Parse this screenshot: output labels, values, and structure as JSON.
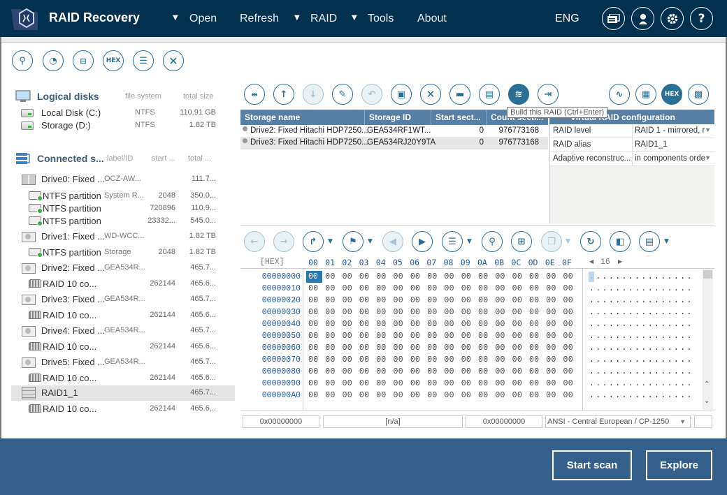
{
  "app": {
    "title": "RAID Recovery"
  },
  "menu": {
    "open": "Open",
    "refresh": "Refresh",
    "raid": "RAID",
    "tools": "Tools",
    "about": "About",
    "lang": "ENG"
  },
  "top_icons": [
    "messages-icon",
    "user-icon",
    "settings-icon",
    "help-icon"
  ],
  "left_toolbar": {
    "hex_label": "HEX"
  },
  "logical_disks": {
    "title": "Logical disks",
    "col_fs": "file system",
    "col_size": "total size",
    "items": [
      {
        "name": "Local Disk (C:)",
        "fs": "NTFS",
        "size": "110.91 GB"
      },
      {
        "name": "Storage (D:)",
        "fs": "NTFS",
        "size": "1.82 TB"
      }
    ]
  },
  "connected": {
    "title": "Connected s...",
    "col_label": "label/ID",
    "col_start": "start ...",
    "col_total": "total ...",
    "items": [
      {
        "type": "drive0",
        "name": "Drive0: Fixed ...",
        "id": "OCZ-AW...",
        "start": "",
        "total": "111.7..."
      },
      {
        "type": "part",
        "name": "NTFS partition",
        "id": "System R...",
        "start": "2048",
        "total": "350.0..."
      },
      {
        "type": "part",
        "name": "NTFS partition",
        "id": "",
        "start": "720896",
        "total": "110.9..."
      },
      {
        "type": "part",
        "name": "NTFS partition",
        "id": "",
        "start": "23332...",
        "total": "545.0..."
      },
      {
        "type": "drive",
        "name": "Drive1: Fixed ...",
        "id": "WD-WCC...",
        "start": "",
        "total": "1.82 TB"
      },
      {
        "type": "part",
        "name": "NTFS partition",
        "id": "Storage",
        "start": "2048",
        "total": "1.82 TB"
      },
      {
        "type": "drive",
        "name": "Drive2: Fixed ...",
        "id": "GEA534R...",
        "start": "",
        "total": "465.7..."
      },
      {
        "type": "raidpart",
        "name": "RAID 10 co...",
        "id": "",
        "start": "262144",
        "total": "465.6..."
      },
      {
        "type": "drive",
        "name": "Drive3: Fixed ...",
        "id": "GEA534R...",
        "start": "",
        "total": "465.7..."
      },
      {
        "type": "raidpart",
        "name": "RAID 10 co...",
        "id": "",
        "start": "262144",
        "total": "465.6..."
      },
      {
        "type": "drive",
        "name": "Drive4: Fixed ...",
        "id": "GEA534R...",
        "start": "",
        "total": "465.7..."
      },
      {
        "type": "raidpart",
        "name": "RAID 10 co...",
        "id": "",
        "start": "262144",
        "total": "465.6..."
      },
      {
        "type": "drive",
        "name": "Drive5: Fixed ...",
        "id": "GEA534R...",
        "start": "",
        "total": "465.7..."
      },
      {
        "type": "raidpart",
        "name": "RAID 10 co...",
        "id": "",
        "start": "262144",
        "total": "465.6..."
      },
      {
        "type": "raidgrp",
        "name": "RAID1_1",
        "id": "",
        "start": "",
        "total": "465.7...",
        "selected": true
      },
      {
        "type": "raidpart",
        "name": "RAID 10 co...",
        "id": "",
        "start": "262144",
        "total": "465.6..."
      }
    ]
  },
  "storage_table": {
    "headers": [
      "Storage name",
      "Storage ID",
      "Start sect...",
      "Count secti..."
    ],
    "rows": [
      {
        "name": "Drive2: Fixed Hitachi HDP7250...",
        "id": "GEA534RF1WT...",
        "start": "0",
        "count": "976773168"
      },
      {
        "name": "Drive3: Fixed Hitachi HDP7250...",
        "id": "GEA534RJ20Y9TA",
        "start": "0",
        "count": "976773168",
        "selected": true
      }
    ]
  },
  "tooltip": "Build this RAID (Ctrl+Enter)",
  "raid_config": {
    "header": "Virtual RAID configuration",
    "rows": [
      {
        "key": "RAID level",
        "value": "RAID 1 - mirrored, r",
        "dropdown": true
      },
      {
        "key": "RAID alias",
        "value": "RAID1_1",
        "dropdown": false
      },
      {
        "key": "Adaptive reconstruc...",
        "value": "in components orde",
        "dropdown": true
      }
    ]
  },
  "hex": {
    "label": "[HEX]",
    "columns": [
      "00",
      "01",
      "02",
      "03",
      "04",
      "05",
      "06",
      "07",
      "08",
      "09",
      "0A",
      "0B",
      "0C",
      "0D",
      "0E",
      "0F"
    ],
    "bytes_per_row": "16",
    "offsets": [
      "00000000",
      "00000010",
      "00000020",
      "00000030",
      "00000040",
      "00000050",
      "00000060",
      "00000070",
      "00000080",
      "00000090",
      "000000A0"
    ],
    "row_bytes": "00 00 00 00 00 00 00 00 00 00 00 00 00 00 00 00",
    "row_ascii": "................",
    "selected_byte": "00"
  },
  "status": {
    "offset": "0x00000000",
    "value": "[n/a]",
    "offset2": "0x00000000",
    "encoding": "ANSI - Central European / CP-1250",
    "extra": ""
  },
  "buttons": {
    "start_scan": "Start scan",
    "explore": "Explore"
  },
  "colors": {
    "topbar": "#02304f",
    "accent": "#2a6f96",
    "table_header": "#5680a6",
    "bottombar": "#335f8a"
  }
}
